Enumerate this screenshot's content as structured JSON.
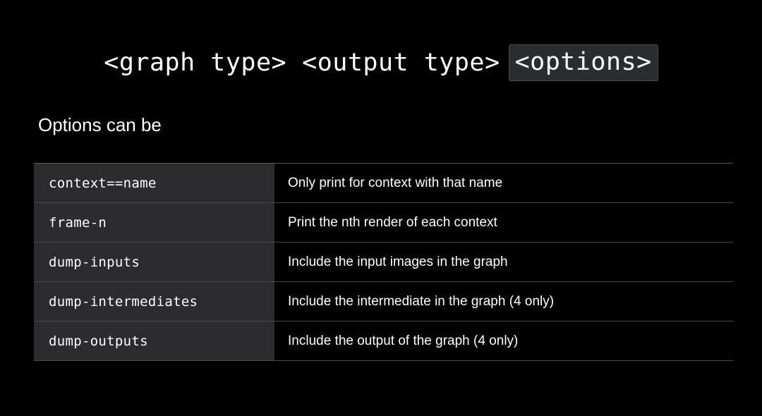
{
  "syntax": {
    "graph_type": "<graph type>",
    "output_type": "<output type>",
    "options": "<options>"
  },
  "heading": "Options can be",
  "options": [
    {
      "name": "context==name",
      "description": "Only print for context with that name"
    },
    {
      "name": "frame-n",
      "description": "Print the nth render of each context"
    },
    {
      "name": "dump-inputs",
      "description": "Include the input images in the graph"
    },
    {
      "name": "dump-intermediates",
      "description": "Include the intermediate in the graph (4 only)"
    },
    {
      "name": "dump-outputs",
      "description": "Include the output of the graph (4 only)"
    }
  ],
  "colors": {
    "background": "#000000",
    "name_cell": "#2c2c2e",
    "highlight_box": "#2a2d30",
    "text": "#ffffff"
  }
}
